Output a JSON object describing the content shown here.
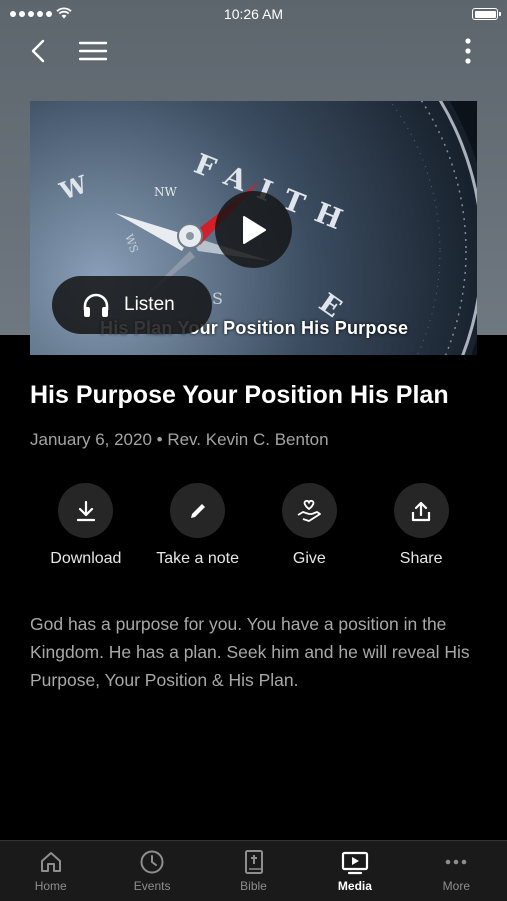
{
  "status_bar": {
    "time": "10:26 AM"
  },
  "nav": {
    "back_icon": "chevron-left-icon",
    "menu_icon": "hamburger-menu-icon",
    "more_icon": "more-vertical-icon"
  },
  "hero": {
    "compass_labels": {
      "faith": "FAITH",
      "nw": "NW",
      "w": "W",
      "e": "E",
      "ws": "WS",
      "s": "S"
    },
    "caption": "His Plan Your Position His Purpose",
    "listen_label": "Listen",
    "play_icon": "play-icon"
  },
  "sermon": {
    "title": "His Purpose Your Position His Plan",
    "meta": "January 6, 2020 • Rev. Kevin C. Benton",
    "description": "God has a purpose for you. You have a position in the Kingdom. He has a plan. Seek him and he will reveal His Purpose, Your Position & His Plan."
  },
  "actions": [
    {
      "label": "Download",
      "icon": "download-icon"
    },
    {
      "label": "Take a note",
      "icon": "pencil-icon"
    },
    {
      "label": "Give",
      "icon": "give-heart-hand-icon"
    },
    {
      "label": "Share",
      "icon": "share-icon"
    }
  ],
  "tabs": [
    {
      "label": "Home",
      "icon": "home-icon",
      "active": false
    },
    {
      "label": "Events",
      "icon": "clock-icon",
      "active": false
    },
    {
      "label": "Bible",
      "icon": "bible-icon",
      "active": false
    },
    {
      "label": "Media",
      "icon": "media-icon",
      "active": true
    },
    {
      "label": "More",
      "icon": "more-horizontal-icon",
      "active": false
    }
  ],
  "colors": {
    "background": "#000000",
    "header": "#6b737b",
    "tab_active": "#ffffff",
    "tab_inactive": "#8e8e8e",
    "accent_red": "#d0202a"
  }
}
